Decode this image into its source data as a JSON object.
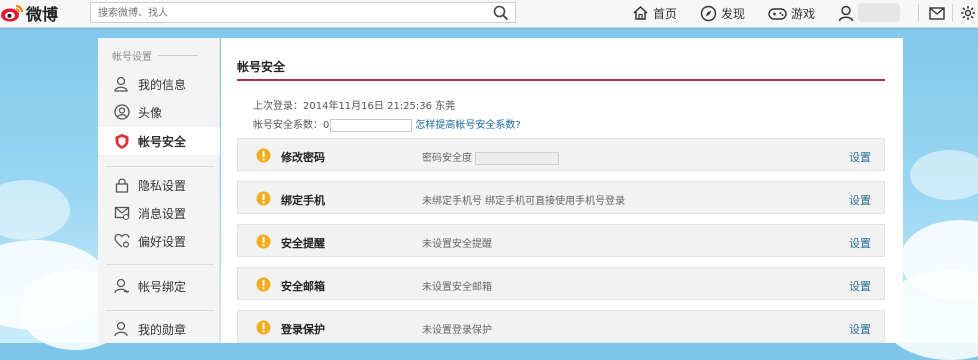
{
  "header": {
    "logo_text": "微博",
    "search_placeholder": "搜索微博、找人",
    "nav": [
      {
        "label": "首页",
        "icon": "home-icon"
      },
      {
        "label": "发现",
        "icon": "compass-icon"
      },
      {
        "label": "游戏",
        "icon": "gamepad-icon"
      }
    ]
  },
  "sidebar": {
    "section_title": "帐号设置",
    "items": [
      {
        "label": "我的信息",
        "icon": "user-icon"
      },
      {
        "label": "头像",
        "icon": "avatar-icon"
      },
      {
        "label": "帐号安全",
        "icon": "shield-icon",
        "active": true
      },
      {
        "label": "隐私设置",
        "icon": "lock-icon"
      },
      {
        "label": "消息设置",
        "icon": "message-icon"
      },
      {
        "label": "偏好设置",
        "icon": "heart-gear-icon"
      },
      {
        "label": "帐号绑定",
        "icon": "user-link-icon"
      },
      {
        "label": "我的勋章",
        "icon": "medal-icon"
      }
    ]
  },
  "main": {
    "title": "帐号安全",
    "last_login": "上次登录：2014年11月16日  21:25:36  东莞",
    "score_label": "帐号安全系数：0",
    "score_link": "怎样提高帐号安全系数?",
    "rows": [
      {
        "label": "修改密码",
        "desc": "密码安全度",
        "action": "设置"
      },
      {
        "label": "绑定手机",
        "desc": "未绑定手机号 绑定手机可直接使用手机号登录",
        "action": "设置"
      },
      {
        "label": "安全提醒",
        "desc": "未设置安全提醒",
        "action": "设置"
      },
      {
        "label": "安全邮箱",
        "desc": "未设置安全邮箱",
        "action": "设置"
      },
      {
        "label": "登录保护",
        "desc": "未设置登录保护",
        "action": "设置"
      }
    ]
  },
  "colors": {
    "accent_rule": "#a5333a",
    "warn": "#f0ad1e",
    "link": "#1c6aa8"
  }
}
